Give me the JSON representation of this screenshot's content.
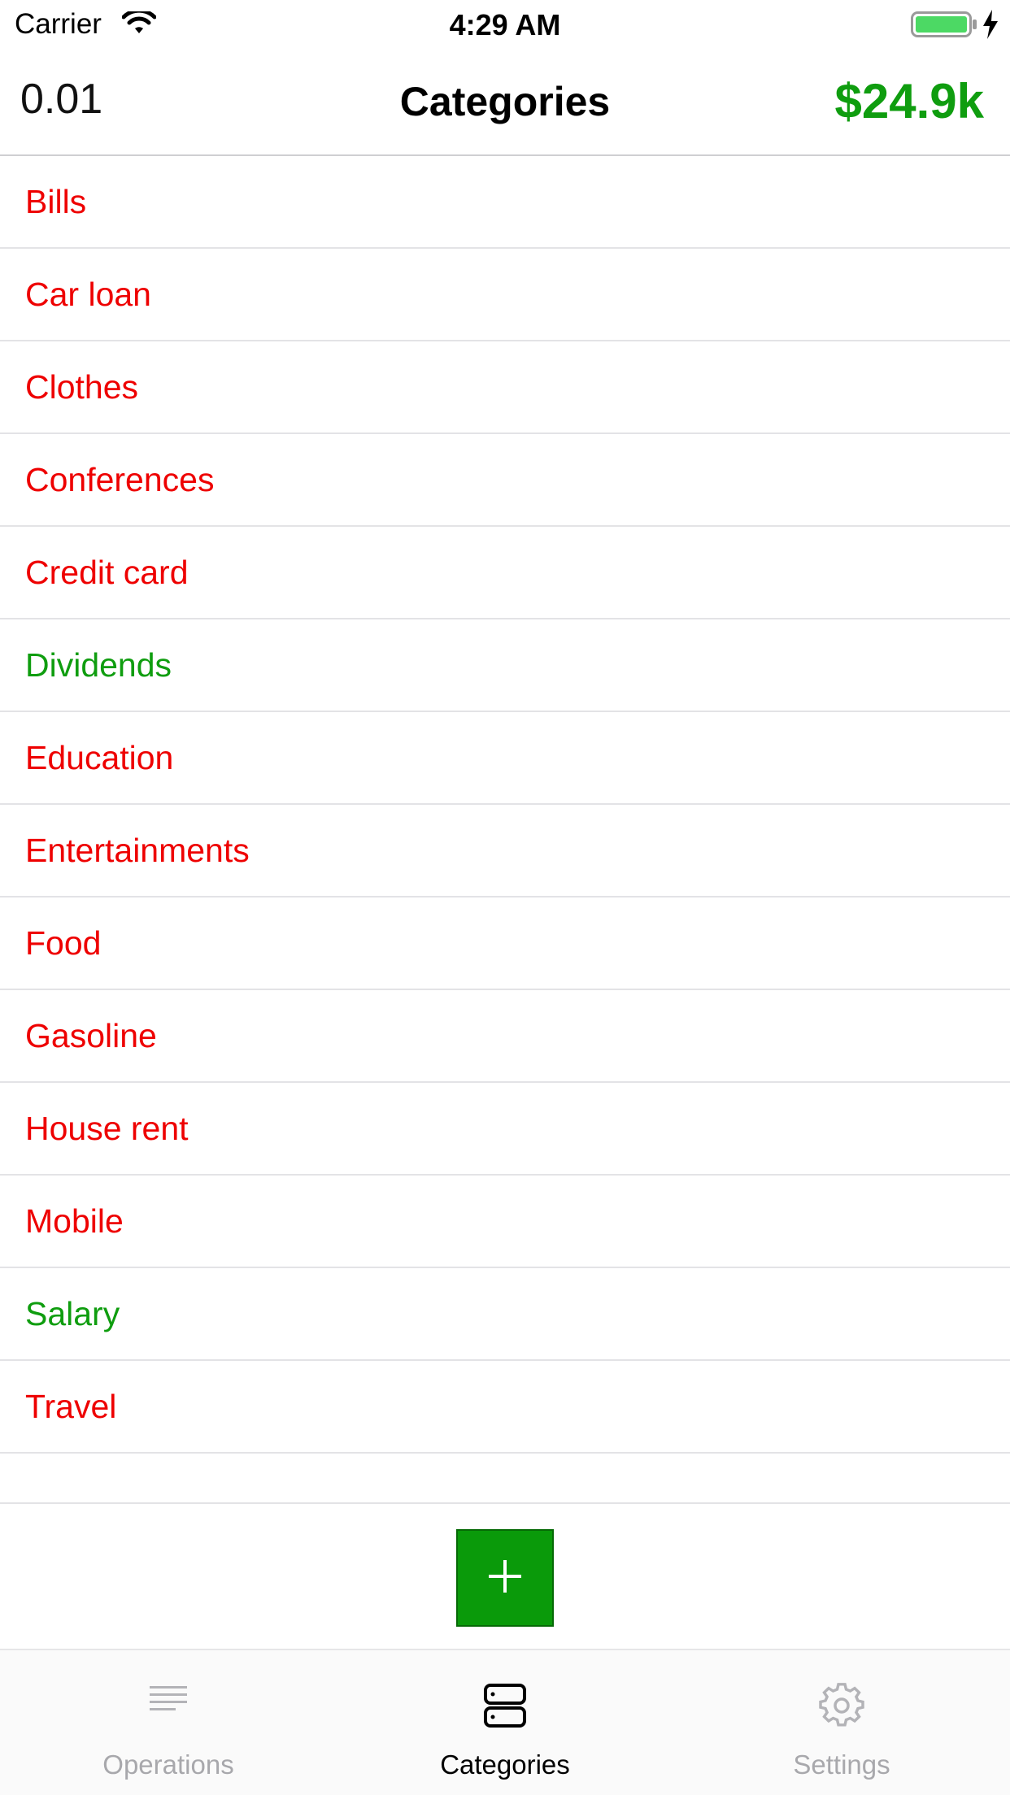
{
  "status_bar": {
    "carrier": "Carrier",
    "time": "4:29 AM",
    "battery_color": "#4cd964"
  },
  "nav": {
    "left_value": "0.01",
    "title": "Categories",
    "balance": "$24.9k",
    "balance_color": "#0f9d0f"
  },
  "categories": [
    {
      "label": "Bills",
      "kind": "expense"
    },
    {
      "label": "Car loan",
      "kind": "expense"
    },
    {
      "label": "Clothes",
      "kind": "expense"
    },
    {
      "label": "Conferences",
      "kind": "expense"
    },
    {
      "label": "Credit card",
      "kind": "expense"
    },
    {
      "label": "Dividends",
      "kind": "income"
    },
    {
      "label": "Education",
      "kind": "expense"
    },
    {
      "label": "Entertainments",
      "kind": "expense"
    },
    {
      "label": "Food",
      "kind": "expense"
    },
    {
      "label": "Gasoline",
      "kind": "expense"
    },
    {
      "label": "House rent",
      "kind": "expense"
    },
    {
      "label": "Mobile",
      "kind": "expense"
    },
    {
      "label": "Salary",
      "kind": "income"
    },
    {
      "label": "Travel",
      "kind": "expense"
    }
  ],
  "colors": {
    "expense": "#ee0000",
    "income": "#0f9d0f",
    "add_button": "#0a9a0a"
  },
  "add_button": {
    "icon": "plus-icon"
  },
  "tabs": [
    {
      "label": "Operations",
      "icon": "list-lines-icon",
      "active": false
    },
    {
      "label": "Categories",
      "icon": "stacked-boxes-icon",
      "active": true
    },
    {
      "label": "Settings",
      "icon": "gear-icon",
      "active": false
    }
  ]
}
